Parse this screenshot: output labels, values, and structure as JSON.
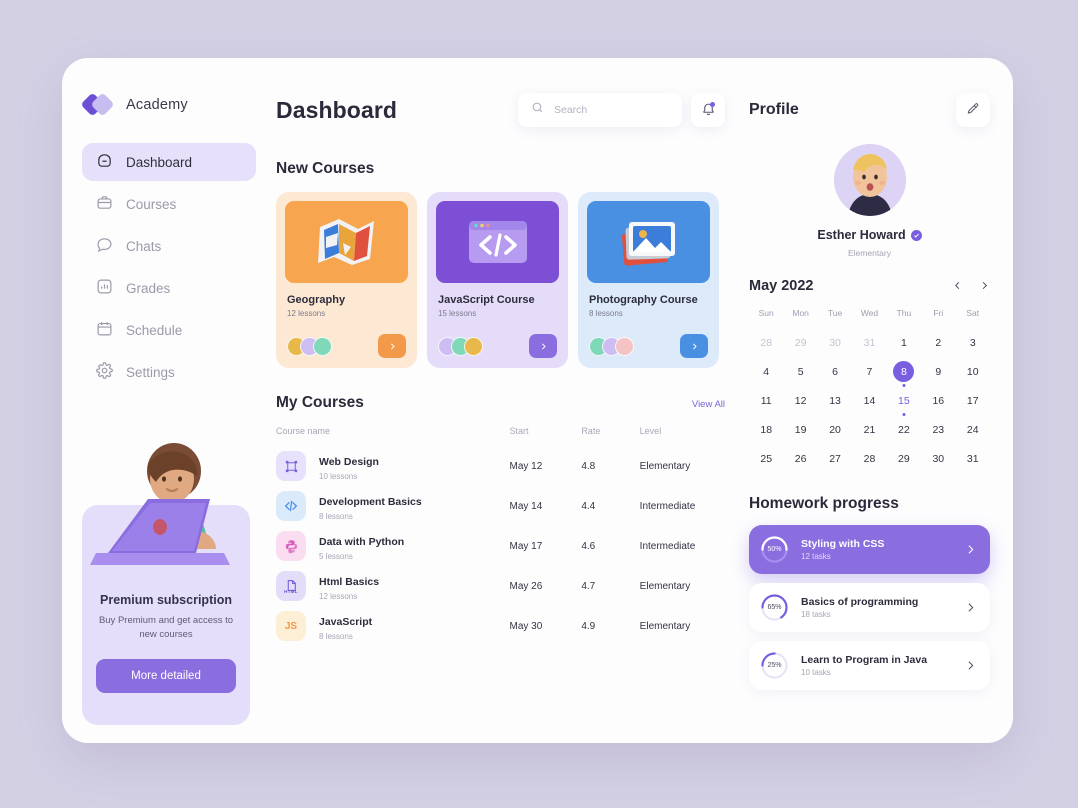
{
  "brand": {
    "name": "Academy"
  },
  "sidebar": {
    "items": [
      {
        "label": "Dashboard",
        "icon": "home-icon",
        "active": true
      },
      {
        "label": "Courses",
        "icon": "briefcase-icon",
        "active": false
      },
      {
        "label": "Chats",
        "icon": "chat-icon",
        "active": false
      },
      {
        "label": "Grades",
        "icon": "bar-chart-icon",
        "active": false
      },
      {
        "label": "Schedule",
        "icon": "calendar-icon",
        "active": false
      },
      {
        "label": "Settings",
        "icon": "gear-icon",
        "active": false
      }
    ],
    "premium": {
      "title": "Premium subscription",
      "text": "Buy Premium and get access to new courses",
      "button": "More detailed"
    }
  },
  "header": {
    "page_title": "Dashboard",
    "search_placeholder": "Search",
    "search_value": "",
    "notifications_icon": "bell-icon",
    "has_notification": true
  },
  "new_courses": {
    "title": "New Courses",
    "cards": [
      {
        "name": "Geography",
        "lessons": "12 lessons",
        "thumb": "world-map-icon",
        "bg": "#fde8d3",
        "thumb_bg": "#f7a64f",
        "btn_bg": "#f2994a",
        "members": 3
      },
      {
        "name": "JavaScript Course",
        "lessons": "15 lessons",
        "thumb": "code-window-icon",
        "bg": "#e4dcf9",
        "thumb_bg": "#7c4fd4",
        "btn_bg": "#8a6ee0",
        "members": 3
      },
      {
        "name": "Photography Course",
        "lessons": "8 lessons",
        "thumb": "photos-icon",
        "bg": "#dceafa",
        "thumb_bg": "#4a90e2",
        "btn_bg": "#4a90e2",
        "members": 3
      }
    ]
  },
  "my_courses": {
    "title": "My Courses",
    "view_all": "View All",
    "columns": [
      "Course name",
      "Start",
      "Rate",
      "Level"
    ],
    "rows": [
      {
        "name": "Web Design",
        "lessons": "10 lessons",
        "start": "May 12",
        "rate": "4.8",
        "level": "Elementary",
        "icon": "frame-icon",
        "icon_bg": "#e8e1fb",
        "icon_fg": "#7a5ee0"
      },
      {
        "name": "Development Basics",
        "lessons": "8 lessons",
        "start": "May 14",
        "rate": "4.4",
        "level": "Intermediate",
        "icon": "code-icon",
        "icon_bg": "#dbeafb",
        "icon_fg": "#4a90e2"
      },
      {
        "name": "Data with Python",
        "lessons": "5 lessons",
        "start": "May 17",
        "rate": "4.6",
        "level": "Intermediate",
        "icon": "python-icon",
        "icon_bg": "#fbddf2",
        "icon_fg": "#d95ab8"
      },
      {
        "name": "Html Basics",
        "lessons": "12 lessons",
        "start": "May 26",
        "rate": "4.7",
        "level": "Elementary",
        "icon": "html-file-icon",
        "icon_bg": "#e3ddfa",
        "icon_fg": "#6d4fd6"
      },
      {
        "name": "JavaScript",
        "lessons": "8 lessons",
        "start": "May 30",
        "rate": "4.9",
        "level": "Elementary",
        "icon": "js-icon",
        "icon_bg": "#fdeed6",
        "icon_fg": "#f2994a"
      }
    ]
  },
  "profile": {
    "title": "Profile",
    "edit_icon": "pencil-icon",
    "name": "Esther Howard",
    "verified": true,
    "level": "Elementary"
  },
  "calendar": {
    "month_label": "May 2022",
    "prev_icon": "chevron-left-icon",
    "next_icon": "chevron-right-icon",
    "weekdays": [
      "Sun",
      "Mon",
      "Tue",
      "Wed",
      "Thu",
      "Fri",
      "Sat"
    ],
    "weeks": [
      [
        {
          "d": "28",
          "muted": true
        },
        {
          "d": "29",
          "muted": true
        },
        {
          "d": "30",
          "muted": true
        },
        {
          "d": "31",
          "muted": true
        },
        {
          "d": "1"
        },
        {
          "d": "2"
        },
        {
          "d": "3"
        }
      ],
      [
        {
          "d": "4"
        },
        {
          "d": "5"
        },
        {
          "d": "6"
        },
        {
          "d": "7"
        },
        {
          "d": "8",
          "selected": true,
          "dot": true
        },
        {
          "d": "9"
        },
        {
          "d": "10"
        }
      ],
      [
        {
          "d": "11"
        },
        {
          "d": "12"
        },
        {
          "d": "13"
        },
        {
          "d": "14"
        },
        {
          "d": "15",
          "marked": true,
          "dot": true
        },
        {
          "d": "16"
        },
        {
          "d": "17"
        }
      ],
      [
        {
          "d": "18"
        },
        {
          "d": "19"
        },
        {
          "d": "20"
        },
        {
          "d": "21"
        },
        {
          "d": "22"
        },
        {
          "d": "23"
        },
        {
          "d": "24"
        }
      ],
      [
        {
          "d": "25"
        },
        {
          "d": "26"
        },
        {
          "d": "27"
        },
        {
          "d": "28"
        },
        {
          "d": "29"
        },
        {
          "d": "30"
        },
        {
          "d": "31"
        }
      ]
    ]
  },
  "homework": {
    "title": "Homework progress",
    "items": [
      {
        "name": "Styling with CSS",
        "tasks": "12 tasks",
        "percent": 50,
        "percent_label": "50%",
        "active": true
      },
      {
        "name": "Basics of programming",
        "tasks": "18 tasks",
        "percent": 65,
        "percent_label": "65%",
        "active": false
      },
      {
        "name": "Learn to Program in Java",
        "tasks": "10 tasks",
        "percent": 25,
        "percent_label": "25%",
        "active": false
      }
    ]
  },
  "colors": {
    "accent": "#7a5ee0",
    "accent_soft": "#8a6ee0",
    "page_bg": "#d4d0e4",
    "card_bg": "#fdfdfe",
    "orange": "#f2994a",
    "blue": "#4a90e2"
  }
}
